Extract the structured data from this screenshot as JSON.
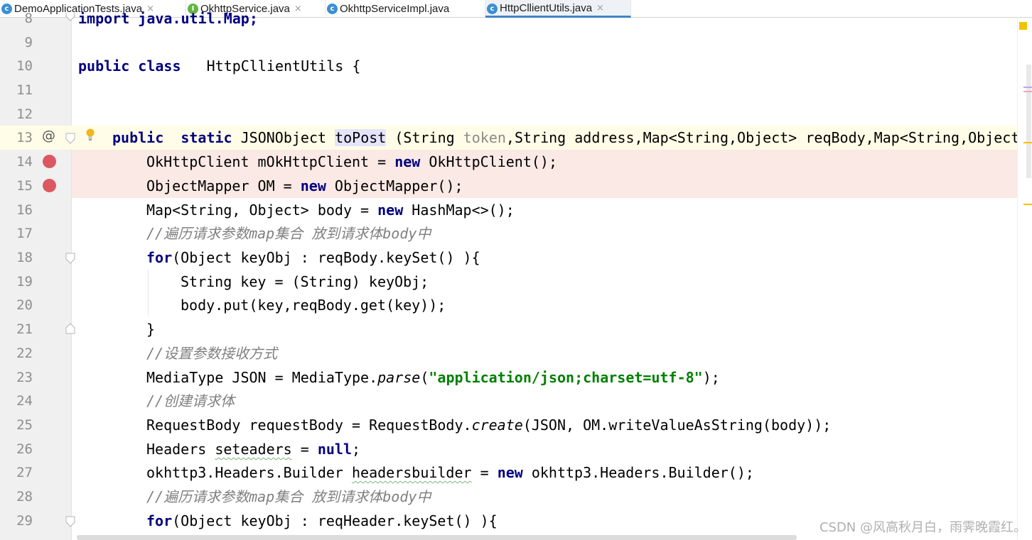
{
  "tabs": [
    {
      "label": "DemoApplicationTests.java",
      "icon": "class-icon",
      "close": "×",
      "active": false
    },
    {
      "label": "OkhttpService.java",
      "icon": "interface-icon",
      "close": "×",
      "active": false
    },
    {
      "label": "OkhttpServiceImpl.java",
      "icon": "class-icon",
      "close": "",
      "active": false
    },
    {
      "label": "HttpCllientUtils.java",
      "icon": "class-icon",
      "close": "×",
      "active": true
    }
  ],
  "tab_icon_letters": {
    "class": "c",
    "interface": "I"
  },
  "editor": {
    "line_numbers": [
      "8",
      "9",
      "10",
      "11",
      "12",
      "13",
      "14",
      "15",
      "16",
      "17",
      "18",
      "19",
      "20",
      "21",
      "22",
      "23",
      "24",
      "25",
      "26",
      "27",
      "28",
      "29"
    ],
    "lines": {
      "l8": [
        "import java.util.Map;"
      ],
      "l10": [
        "public class",
        "   HttpCllientUtils {"
      ],
      "l13": [
        "public",
        "  static",
        " JSONObject ",
        "toPost",
        " (String ",
        "token",
        ",String address,Map<String,Object> reqBody,Map<String,Object>"
      ],
      "l14": [
        "OkHttpClient mOkHttpClient = ",
        "new",
        " OkHttpClient();"
      ],
      "l15": [
        "ObjectMapper OM = ",
        "new",
        " ObjectMapper();"
      ],
      "l16": [
        "Map<String, Object> body = ",
        "new",
        " HashMap<>();"
      ],
      "l17": [
        "//遍历请求参数map集合 放到请求体body中"
      ],
      "l18": [
        "for",
        "(Object keyObj : reqBody.keySet() ){"
      ],
      "l19": [
        "String key = (String) keyObj;"
      ],
      "l20": [
        "body.put(key,reqBody.get(key));"
      ],
      "l21": [
        "}"
      ],
      "l22": [
        "//设置参数接收方式"
      ],
      "l23": [
        "MediaType JSON = MediaType.",
        "parse",
        "(",
        "\"application/json;charset=utf-8\"",
        ");"
      ],
      "l24": [
        "//创建请求体"
      ],
      "l25": [
        "RequestBody requestBody = RequestBody.",
        "create",
        "(JSON, OM.writeValueAsString(body));"
      ],
      "l26": [
        "Headers ",
        "seteaders",
        " = ",
        "null",
        ";"
      ],
      "l27": [
        "okhttp3.Headers.Builder ",
        "headersbuilder",
        " = ",
        "new",
        " okhttp3.Headers.Builder();"
      ],
      "l28": [
        "//遍历请求参数map集合 放到请求体body中"
      ],
      "l29": [
        "for",
        "(Object keyObj : reqHeader.keySet() ){"
      ]
    },
    "gutter_icons": {
      "override": "@",
      "bulb": "lightbulb-icon",
      "breakpoint_lines": [
        "14",
        "15"
      ]
    }
  },
  "watermark": "CSDN @风高秋月白，雨霁晚霞红。",
  "colors": {
    "keyword": "#000080",
    "string": "#008000",
    "comment": "#808080",
    "breakpoint": "#db5860",
    "breakpoint_row": "#fae9e5",
    "active_tab_underline": "#4083c9"
  }
}
